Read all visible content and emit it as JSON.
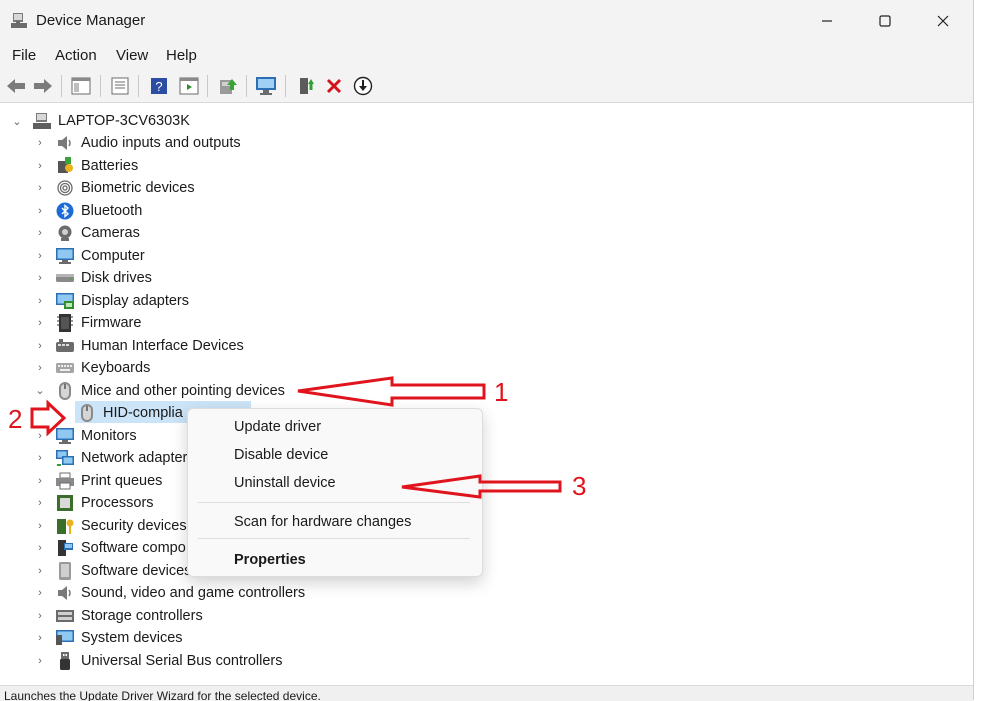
{
  "window": {
    "title": "Device Manager"
  },
  "menu": [
    "File",
    "Action",
    "View",
    "Help"
  ],
  "tree": {
    "root": "LAPTOP-3CV6303K",
    "categories": [
      {
        "label": "Audio inputs and outputs",
        "icon": "speaker-icon",
        "expanded": false
      },
      {
        "label": "Batteries",
        "icon": "battery-icon",
        "expanded": false
      },
      {
        "label": "Biometric devices",
        "icon": "fingerprint-icon",
        "expanded": false
      },
      {
        "label": "Bluetooth",
        "icon": "bluetooth-icon",
        "expanded": false
      },
      {
        "label": "Cameras",
        "icon": "camera-icon",
        "expanded": false
      },
      {
        "label": "Computer",
        "icon": "monitor-icon",
        "expanded": false
      },
      {
        "label": "Disk drives",
        "icon": "disk-icon",
        "expanded": false
      },
      {
        "label": "Display adapters",
        "icon": "display-adapter-icon",
        "expanded": false
      },
      {
        "label": "Firmware",
        "icon": "chip-icon",
        "expanded": false
      },
      {
        "label": "Human Interface Devices",
        "icon": "hid-icon",
        "expanded": false
      },
      {
        "label": "Keyboards",
        "icon": "keyboard-icon",
        "expanded": false
      },
      {
        "label": "Mice and other pointing devices",
        "icon": "mouse-icon",
        "expanded": true
      },
      {
        "label": "HID-complia",
        "icon": "mouse-icon",
        "child": true,
        "selected": true
      },
      {
        "label": "Monitors",
        "icon": "monitor-icon",
        "expanded": false
      },
      {
        "label": "Network adapter",
        "icon": "network-icon",
        "expanded": false
      },
      {
        "label": "Print queues",
        "icon": "printer-icon",
        "expanded": false
      },
      {
        "label": "Processors",
        "icon": "processor-icon",
        "expanded": false
      },
      {
        "label": "Security devices",
        "icon": "security-icon",
        "expanded": false
      },
      {
        "label": "Software compo",
        "icon": "software-component-icon",
        "expanded": false
      },
      {
        "label": "Software devices",
        "icon": "software-device-icon",
        "expanded": false
      },
      {
        "label": "Sound, video and game controllers",
        "icon": "speaker-icon",
        "expanded": false
      },
      {
        "label": "Storage controllers",
        "icon": "storage-icon",
        "expanded": false
      },
      {
        "label": "System devices",
        "icon": "system-icon",
        "expanded": false
      },
      {
        "label": "Universal Serial Bus controllers",
        "icon": "usb-icon",
        "expanded": false
      }
    ]
  },
  "context_menu": {
    "update": "Update driver",
    "disable": "Disable device",
    "uninstall": "Uninstall device",
    "scan": "Scan for hardware changes",
    "properties": "Properties"
  },
  "annotations": {
    "a1": "1",
    "a2": "2",
    "a3": "3"
  },
  "status": "Launches the Update Driver Wizard for the selected device.",
  "colors": {
    "annotation": "#e0141d",
    "selection": "#cce4f7",
    "chrome": "#f3f3f3"
  }
}
